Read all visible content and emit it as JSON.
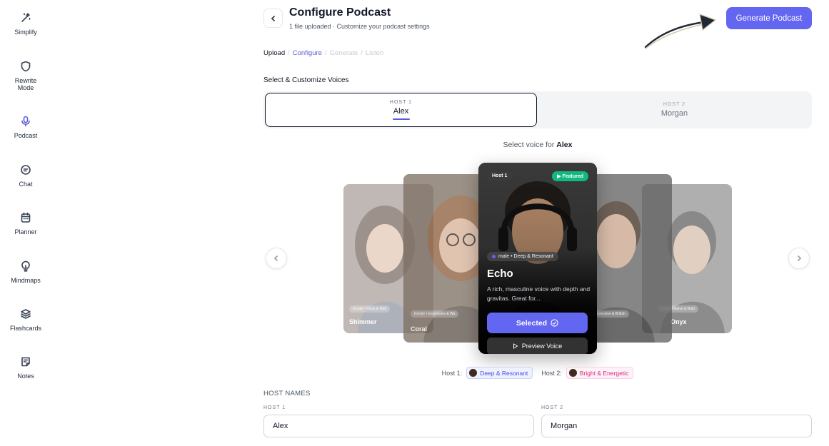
{
  "sidebar": {
    "items": [
      {
        "label": "Simplify",
        "icon": "magic-wand-icon"
      },
      {
        "label": "Rewrite Mode",
        "icon": "shield-icon"
      },
      {
        "label": "Podcast",
        "icon": "microphone-icon",
        "active": true
      },
      {
        "label": "Chat",
        "icon": "chat-bubble-icon"
      },
      {
        "label": "Planner",
        "icon": "calendar-icon"
      },
      {
        "label": "Mindmaps",
        "icon": "lightbulb-icon"
      },
      {
        "label": "Flashcards",
        "icon": "layers-icon"
      },
      {
        "label": "Notes",
        "icon": "note-icon"
      }
    ]
  },
  "header": {
    "title": "Configure Podcast",
    "subtitle": "1 file uploaded · Customize your podcast settings",
    "generate_label": "Generate Podcast"
  },
  "breadcrumb": {
    "steps": [
      "Upload",
      "Configure",
      "Generate",
      "Listen"
    ],
    "current": "Configure"
  },
  "voices_section": {
    "title": "Select & Customize Voices",
    "tabs": [
      {
        "small": "HOST 1",
        "name": "Alex"
      },
      {
        "small": "HOST 2",
        "name": "Morgan"
      }
    ],
    "select_prefix": "Select voice for",
    "select_host": "Alex"
  },
  "carousel": {
    "side_cards": [
      {
        "name": "Shimmer",
        "tag": "female • Clear & Mod"
      },
      {
        "name": "Coral",
        "tag": "female • Expressive & Wa"
      },
      {
        "name": "",
        "tag": "• Expressive & British"
      },
      {
        "name": "Onyx",
        "tag": "• Authoritative & Bold"
      }
    ],
    "center": {
      "host_chip": "Host 1",
      "featured": "Featured",
      "trait": "male • Deep & Resonant",
      "name": "Echo",
      "description": "A rich, masculine voice with depth and gravitas. Great for...",
      "selected_label": "Selected",
      "preview_label": "Preview Voice"
    }
  },
  "host_summary": {
    "host1_label": "Host 1:",
    "host1_trait": "Deep & Resonant",
    "host2_label": "Host 2:",
    "host2_trait": "Bright & Energetic"
  },
  "host_names": {
    "title": "HOST NAMES",
    "host1_label": "HOST 1",
    "host1_value": "Alex",
    "host2_label": "HOST 2",
    "host2_value": "Morgan"
  },
  "colors": {
    "accent": "#6366f1",
    "featured": "#10b981"
  }
}
